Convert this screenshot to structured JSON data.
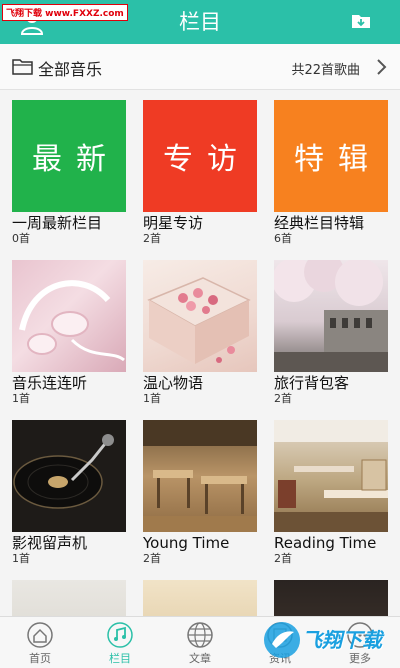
{
  "header": {
    "title": "栏目",
    "watermark": "飞翔下载 www.FXXZ.com"
  },
  "subbar": {
    "label": "全部音乐",
    "count": "共22首歌曲"
  },
  "cards": [
    {
      "name": "一周最新栏目",
      "count": "0首",
      "tile_text": "最新",
      "color": "#21b24b"
    },
    {
      "name": "明星专访",
      "count": "2首",
      "tile_text": "专访",
      "color": "#ef3b24"
    },
    {
      "name": "经典栏目特辑",
      "count": "6首",
      "tile_text": "特辑",
      "color": "#f7811f"
    },
    {
      "name": "音乐连连听",
      "count": "1首"
    },
    {
      "name": "温心物语",
      "count": "1首"
    },
    {
      "name": "旅行背包客",
      "count": "2首"
    },
    {
      "name": "影视留声机",
      "count": "1首"
    },
    {
      "name": "Young Time",
      "count": "2首"
    },
    {
      "name": "Reading Time",
      "count": "2首"
    }
  ],
  "tabs": [
    {
      "label": "首页",
      "icon": "home-icon"
    },
    {
      "label": "栏目",
      "icon": "music-note-icon"
    },
    {
      "label": "文章",
      "icon": "globe-icon"
    },
    {
      "label": "资讯",
      "icon": "news-icon"
    },
    {
      "label": "更多",
      "icon": "more-icon"
    }
  ],
  "overlay_logo": "飞翔下载",
  "colors": {
    "accent": "#2bc0a8",
    "latest_tile": "#21b24b",
    "interview_tile": "#ef3b24",
    "special_tile": "#f7811f"
  }
}
